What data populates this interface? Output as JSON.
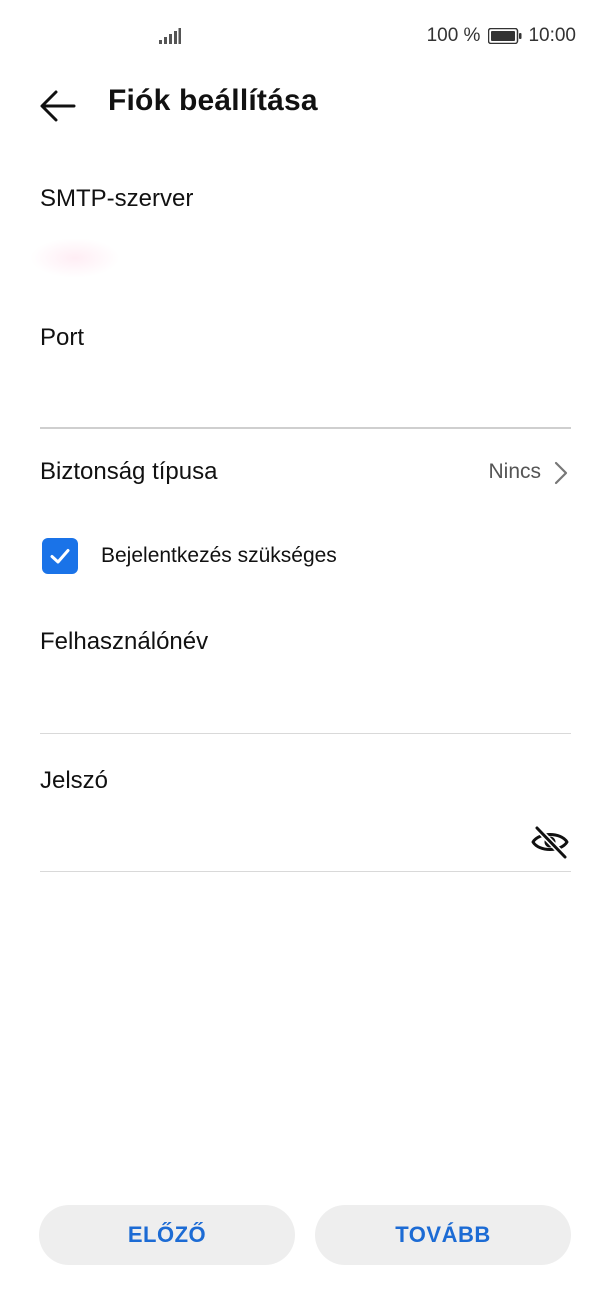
{
  "status_bar": {
    "battery_percent": "100 %",
    "time": "10:00",
    "icons": [
      "signal-icon",
      "battery-icon"
    ]
  },
  "header": {
    "title": "Fiók beállítása",
    "back_icon": "arrow-left-icon"
  },
  "fields": {
    "smtp_server": {
      "label": "SMTP-szerver",
      "value": ""
    },
    "port": {
      "label": "Port",
      "value": ""
    },
    "security_type": {
      "label": "Biztonság típusa",
      "value": "Nincs"
    },
    "login_required": {
      "label": "Bejelentkezés szükséges",
      "checked": true
    },
    "username": {
      "label": "Felhasználónév",
      "value": ""
    },
    "password": {
      "label": "Jelszó",
      "value": "",
      "visibility_icon": "eye-off-icon"
    }
  },
  "buttons": {
    "previous": "ELŐZŐ",
    "next": "TOVÁBB"
  },
  "colors": {
    "accent": "#1a73e8",
    "button_text": "#1c6bd4",
    "button_bg": "#eeeeee",
    "divider": "#d9d9d9"
  }
}
